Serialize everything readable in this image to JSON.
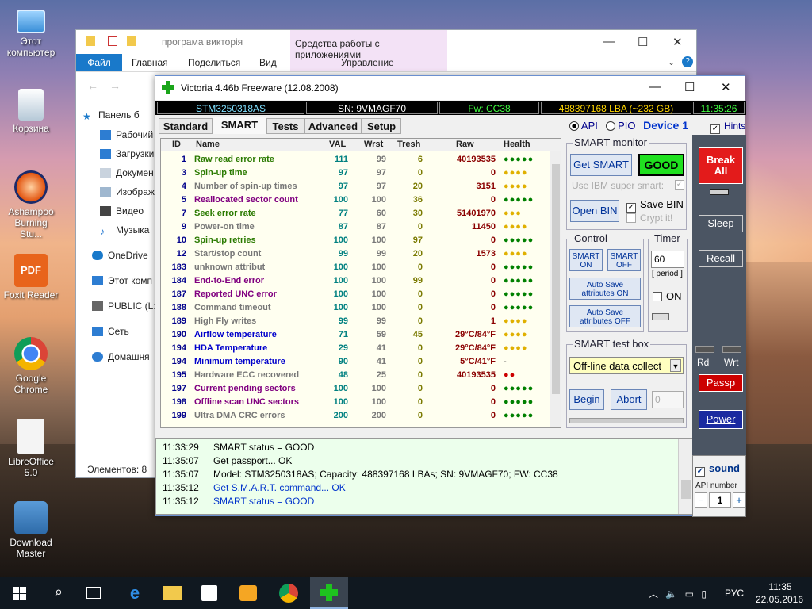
{
  "desktop": {
    "icons": [
      {
        "label": "Этот компьютер",
        "icon": "computer-icon"
      },
      {
        "label": "Корзина",
        "icon": "recycle-bin-icon"
      },
      {
        "label": "Ashampoo Burning Stu...",
        "icon": "ashampoo-icon"
      },
      {
        "label": "Foxit Reader",
        "icon": "pdf-icon"
      },
      {
        "label": "Google Chrome",
        "icon": "chrome-icon"
      },
      {
        "label": "LibreOffice 5.0",
        "icon": "libreoffice-icon"
      },
      {
        "label": "Download Master",
        "icon": "download-master-icon"
      }
    ]
  },
  "explorer": {
    "title": "програма викторія",
    "context_title": "Средства работы с приложениями",
    "ribbon_tabs": [
      "Файл",
      "Главная",
      "Поделиться",
      "Вид",
      "Управление"
    ],
    "nav": [
      "Панель б",
      "Рабочий",
      "Загрузки",
      "Докумен",
      "Изображ",
      "Видео",
      "Музыка",
      "OneDrive",
      "Этот комп",
      "PUBLIC (L:",
      "Сеть",
      "Домашня"
    ],
    "status": "Элементов: 8"
  },
  "victoria": {
    "title": "Victoria 4.46b Freeware (12.08.2008)",
    "drive_model": "STM3250318AS",
    "serial": "SN: 9VMAGF70",
    "firmware": "Fw: CC38",
    "capacity": "488397168 LBA (~232 GB)",
    "clock": "11:35:26",
    "tabs": [
      "Standard",
      "SMART",
      "Tests",
      "Advanced",
      "Setup"
    ],
    "active_tab": "SMART",
    "api_label": "API",
    "pio_label": "PIO",
    "device_label": "Device 1",
    "hints_label": "Hints",
    "columns": [
      "ID",
      "Name",
      "VAL",
      "Wrst",
      "Tresh",
      "Raw",
      "Health"
    ],
    "attributes": [
      {
        "id": "1",
        "name": "Raw read error rate",
        "val": "111",
        "wrst": "99",
        "tresh": "6",
        "raw": "40193535",
        "health": "●●●●●",
        "color": "#2a7a00",
        "hcolor": "#008000"
      },
      {
        "id": "3",
        "name": "Spin-up time",
        "val": "97",
        "wrst": "97",
        "tresh": "0",
        "raw": "0",
        "health": "●●●●",
        "color": "#2a7a00",
        "hcolor": "#e0b000"
      },
      {
        "id": "4",
        "name": "Number of spin-up times",
        "val": "97",
        "wrst": "97",
        "tresh": "20",
        "raw": "3151",
        "health": "●●●●",
        "color": "#777777",
        "hcolor": "#e0b000"
      },
      {
        "id": "5",
        "name": "Reallocated sector count",
        "val": "100",
        "wrst": "100",
        "tresh": "36",
        "raw": "0",
        "health": "●●●●●",
        "color": "#800080",
        "hcolor": "#008000"
      },
      {
        "id": "7",
        "name": "Seek error rate",
        "val": "77",
        "wrst": "60",
        "tresh": "30",
        "raw": "51401970",
        "health": "●●●",
        "color": "#2a7a00",
        "hcolor": "#e0b000"
      },
      {
        "id": "9",
        "name": "Power-on time",
        "val": "87",
        "wrst": "87",
        "tresh": "0",
        "raw": "11450",
        "health": "●●●●",
        "color": "#777777",
        "hcolor": "#e0b000"
      },
      {
        "id": "10",
        "name": "Spin-up retries",
        "val": "100",
        "wrst": "100",
        "tresh": "97",
        "raw": "0",
        "health": "●●●●●",
        "color": "#2a7a00",
        "hcolor": "#008000"
      },
      {
        "id": "12",
        "name": "Start/stop count",
        "val": "99",
        "wrst": "99",
        "tresh": "20",
        "raw": "1573",
        "health": "●●●●",
        "color": "#777777",
        "hcolor": "#e0b000"
      },
      {
        "id": "183",
        "name": "unknown attribut",
        "val": "100",
        "wrst": "100",
        "tresh": "0",
        "raw": "0",
        "health": "●●●●●",
        "color": "#777777",
        "hcolor": "#008000"
      },
      {
        "id": "184",
        "name": "End-to-End error",
        "val": "100",
        "wrst": "100",
        "tresh": "99",
        "raw": "0",
        "health": "●●●●●",
        "color": "#800080",
        "hcolor": "#008000"
      },
      {
        "id": "187",
        "name": "Reported UNC error",
        "val": "100",
        "wrst": "100",
        "tresh": "0",
        "raw": "0",
        "health": "●●●●●",
        "color": "#800080",
        "hcolor": "#008000"
      },
      {
        "id": "188",
        "name": "Command timeout",
        "val": "100",
        "wrst": "100",
        "tresh": "0",
        "raw": "0",
        "health": "●●●●●",
        "color": "#777777",
        "hcolor": "#008000"
      },
      {
        "id": "189",
        "name": "High Fly writes",
        "val": "99",
        "wrst": "99",
        "tresh": "0",
        "raw": "1",
        "health": "●●●●",
        "color": "#777777",
        "hcolor": "#e0b000"
      },
      {
        "id": "190",
        "name": "Airflow temperature",
        "val": "71",
        "wrst": "59",
        "tresh": "45",
        "raw": "29°C/84°F",
        "health": "●●●●",
        "color": "#0000cc",
        "hcolor": "#e0b000"
      },
      {
        "id": "194",
        "name": "HDA Temperature",
        "val": "29",
        "wrst": "41",
        "tresh": "0",
        "raw": "29°C/84°F",
        "health": "●●●●",
        "color": "#0000cc",
        "hcolor": "#e0b000"
      },
      {
        "id": "194",
        "name": "Minimum temperature",
        "val": "90",
        "wrst": "41",
        "tresh": "0",
        "raw": "5°C/41°F",
        "health": "-",
        "color": "#0000cc",
        "hcolor": "#333333"
      },
      {
        "id": "195",
        "name": "Hardware ECC recovered",
        "val": "48",
        "wrst": "25",
        "tresh": "0",
        "raw": "40193535",
        "health": "●●",
        "color": "#777777",
        "hcolor": "#cc0000"
      },
      {
        "id": "197",
        "name": "Current pending sectors",
        "val": "100",
        "wrst": "100",
        "tresh": "0",
        "raw": "0",
        "health": "●●●●●",
        "color": "#800080",
        "hcolor": "#008000"
      },
      {
        "id": "198",
        "name": "Offline scan UNC sectors",
        "val": "100",
        "wrst": "100",
        "tresh": "0",
        "raw": "0",
        "health": "●●●●●",
        "color": "#800080",
        "hcolor": "#008000"
      },
      {
        "id": "199",
        "name": "Ultra DMA CRC errors",
        "val": "200",
        "wrst": "200",
        "tresh": "0",
        "raw": "0",
        "health": "●●●●●",
        "color": "#777777",
        "hcolor": "#008000"
      }
    ],
    "smart_monitor": {
      "label": "SMART monitor",
      "get_smart": "Get SMART",
      "status": "GOOD",
      "use_ibm": "Use IBM super smart:",
      "open_bin": "Open BIN",
      "save_bin": "Save BIN",
      "crypt": "Crypt it!"
    },
    "control": {
      "label": "Control",
      "smart_on": "SMART ON",
      "smart_off": "SMART OFF",
      "autosave_on": "Auto Save attributes ON",
      "autosave_off": "Auto Save attributes OFF"
    },
    "timer": {
      "label": "Timer",
      "value": "60",
      "period": "[ period ]",
      "on": "ON"
    },
    "test_box": {
      "label": "SMART test box",
      "selected": "Off-line data collect",
      "begin": "Begin",
      "abort": "Abort",
      "count": "0"
    },
    "log": [
      {
        "time": "11:33:29",
        "text": "SMART status = GOOD",
        "color": "#000000"
      },
      {
        "time": "11:35:07",
        "text": "Get passport... OK",
        "color": "#000000"
      },
      {
        "time": "11:35:07",
        "text": "Model: STM3250318AS; Capacity: 488397168 LBAs; SN: 9VMAGF70; FW: CC38",
        "color": "#000000"
      },
      {
        "time": "11:35:12",
        "text": "Get S.M.A.R.T. command... OK",
        "color": "#0033cc"
      },
      {
        "time": "11:35:12",
        "text": "SMART status = GOOD",
        "color": "#0033cc"
      }
    ],
    "right": {
      "break_all": "Break All",
      "sleep": "Sleep",
      "recall": "Recall",
      "rd": "Rd",
      "wrt": "Wrt",
      "passp": "Passp",
      "power": "Power",
      "sound": "sound",
      "api_number": "API number",
      "api_value": "1"
    }
  },
  "taskbar": {
    "lang": "РУС",
    "time": "11:35",
    "date": "22.05.2016"
  }
}
